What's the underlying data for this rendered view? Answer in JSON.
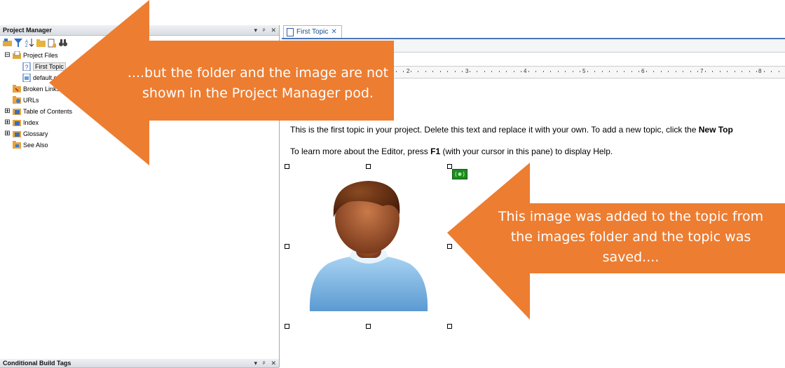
{
  "project_manager": {
    "title": "Project Manager",
    "controls": {
      "dropdown": "▾",
      "pin": "ᵖ",
      "close": "✕"
    },
    "tree": [
      {
        "label": "Project Files",
        "expander": "⊟"
      },
      {
        "label": "First Topic"
      },
      {
        "label": "default.css"
      },
      {
        "label": "Broken Links"
      },
      {
        "label": "URLs"
      },
      {
        "label": "Table of Contents",
        "expander": "⊞"
      },
      {
        "label": "Index",
        "expander": "⊞"
      },
      {
        "label": "Glossary",
        "expander": "⊞"
      },
      {
        "label": "See Also"
      }
    ]
  },
  "conditional_pod": {
    "title": "Conditional Build Tags"
  },
  "editor": {
    "tab_label": "First Topic",
    "tab_close": "✕",
    "ruler_numbers": [
      "2",
      "3",
      "4",
      "5",
      "6",
      "7",
      "8"
    ],
    "para1_prefix": "This is the first topic in your project. Delete this text and replace it with your own. To add a new topic, click the ",
    "para1_bold": "New Top",
    "para2_prefix": "To learn more about the Editor, press ",
    "para2_bold": "F1",
    "para2_suffix": " (with your cursor in this pane) to display Help."
  },
  "callouts": {
    "left": {
      "line1": "....but the folder and the image are not",
      "line2": "shown in the Project Manager pod."
    },
    "right": {
      "line1": "This image was added to the topic from",
      "line2": "the images folder and the topic was",
      "line3": "saved...."
    },
    "color": "#ed7d31"
  }
}
